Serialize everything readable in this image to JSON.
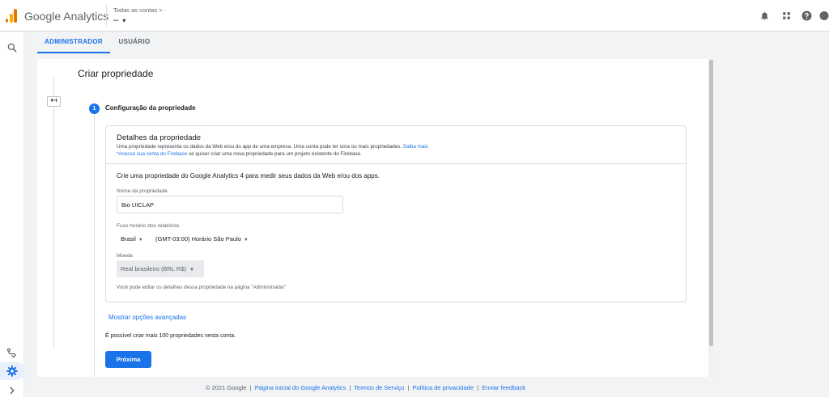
{
  "header": {
    "app_title": "Google Analytics",
    "account_breadcrumb": "Todas as contas",
    "breadcrumb_chevron": ">",
    "breadcrumb_dot": "·",
    "account_name": "–",
    "account_caret": "▾"
  },
  "tabs": [
    {
      "label": "ADMINISTRADOR",
      "active": true
    },
    {
      "label": "USUÁRIO",
      "active": false
    }
  ],
  "page": {
    "title": "Criar propriedade",
    "back_glyph": "↤",
    "step_number": "1",
    "step_title": "Configuração da propriedade"
  },
  "details": {
    "title": "Detalhes da propriedade",
    "description": "Uma propriedade representa os dados da Web e/ou do app de uma empresa. Uma conta pode ter uma ou mais propriedades.",
    "learn_more": "Saiba mais",
    "firebase_prefix": "*",
    "firebase_link": "Acesse sua conta do Firebase",
    "firebase_suffix": " se quiser criar uma nova propriedade para um projeto existente do Firebase.",
    "intro": "Crie uma propriedade do Google Analytics 4 para medir seus dados da Web e/ou dos apps.",
    "name_label": "Nome da propriedade",
    "name_value": "Bio UICLAP",
    "timezone_label": "Fuso horário dos relatórios",
    "country_value": "Brasil",
    "timezone_value": "(GMT-03:00) Horário São Paulo",
    "currency_label": "Moeda",
    "currency_value": "Real brasileiro (BRL R$)",
    "edit_note": "Você pode editar os detalhes dessa propriedade na página \"Administrador\""
  },
  "advanced_link": "Mostrar opções avançadas",
  "limit_text": "É possível criar mais 100 propriedades nesta conta.",
  "next_button": "Próxima",
  "footer": {
    "copyright": "© 2021 Google",
    "home_link": "Página inicial do Google Analytics",
    "terms_link": "Termos de Serviço",
    "privacy_link": "Política de privacidade",
    "feedback_link": "Enviar feedback",
    "separator": "|"
  },
  "colors": {
    "accent": "#1a73e8",
    "logo_orange": "#e37400",
    "logo_yellow": "#f9ab00"
  },
  "icons": {
    "header": [
      "bell-icon",
      "apps-grid-icon",
      "help-icon",
      "account-avatar-icon"
    ],
    "rail": [
      "search-icon",
      "route-icon",
      "gear-icon",
      "chevron-right-icon"
    ]
  }
}
